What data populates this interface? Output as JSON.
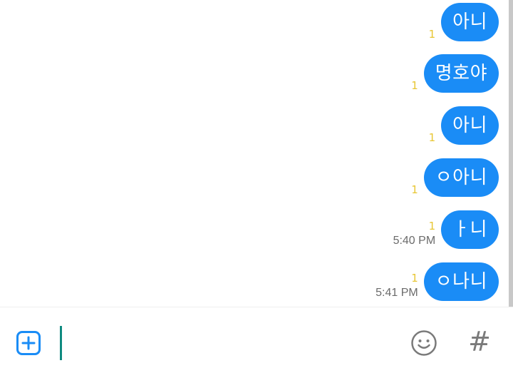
{
  "messages": [
    {
      "text": "아니",
      "unread": "1",
      "time": ""
    },
    {
      "text": "명호야",
      "unread": "1",
      "time": ""
    },
    {
      "text": "아니",
      "unread": "1",
      "time": ""
    },
    {
      "text": "ㅇ아니",
      "unread": "1",
      "time": ""
    },
    {
      "text": "ㅏ니",
      "unread": "1",
      "time": "5:40 PM"
    },
    {
      "text": "ㅇ나니",
      "unread": "1",
      "time": "5:41 PM"
    }
  ],
  "input_bar": {
    "hash_label": "#"
  },
  "colors": {
    "bubble": "#1a8cf6",
    "unread": "#e8c633",
    "cursor": "#0f8a80",
    "plus_icon": "#1a8cf6"
  },
  "icons": {
    "attach": "plus-icon",
    "emoji": "smiley-icon",
    "hashtag": "hash-icon"
  }
}
